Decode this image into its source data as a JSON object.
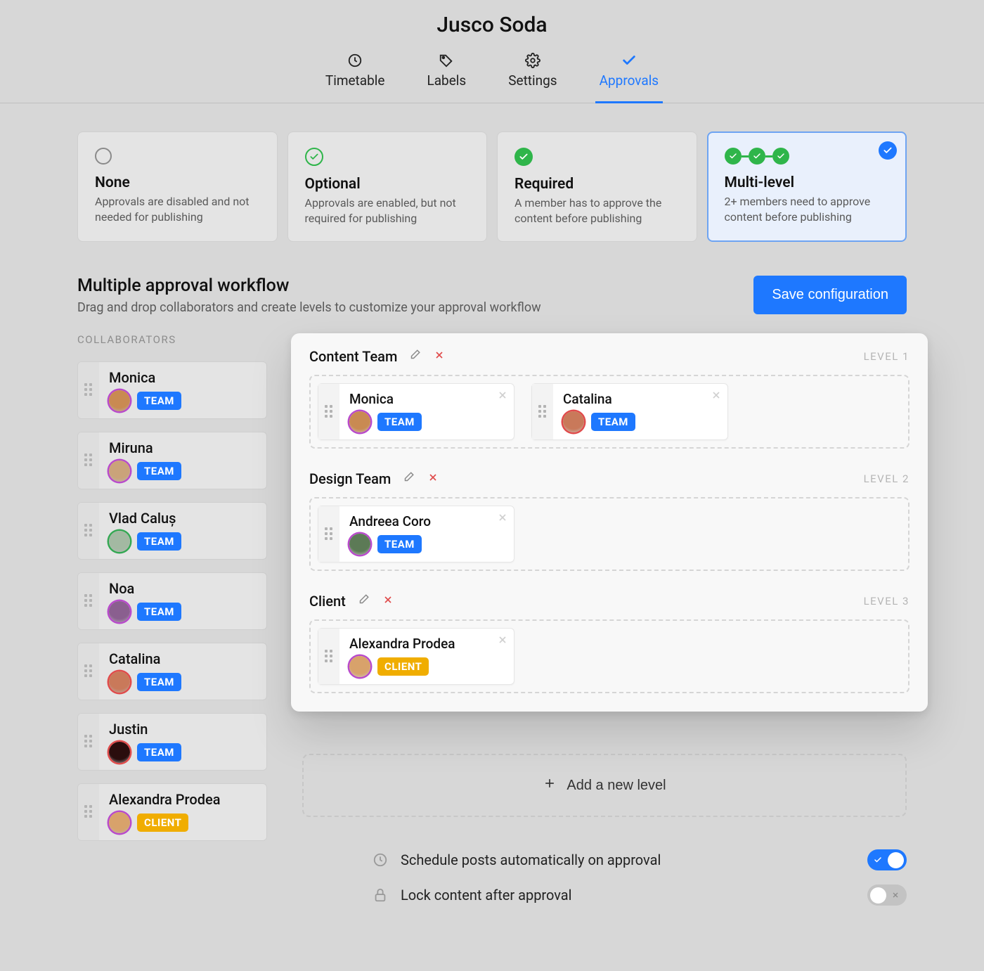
{
  "title": "Jusco Soda",
  "tabs": [
    {
      "label": "Timetable",
      "active": false
    },
    {
      "label": "Labels",
      "active": false
    },
    {
      "label": "Settings",
      "active": false
    },
    {
      "label": "Approvals",
      "active": true
    }
  ],
  "modes": [
    {
      "title": "None",
      "desc": "Approvals are disabled and not needed for publishing",
      "selected": false,
      "style": "none"
    },
    {
      "title": "Optional",
      "desc": "Approvals are enabled, but not required for publishing",
      "selected": false,
      "style": "optional"
    },
    {
      "title": "Required",
      "desc": "A member has to approve the content before publishing",
      "selected": false,
      "style": "required"
    },
    {
      "title": "Multi-level",
      "desc": "2+ members need to approve content before publishing",
      "selected": true,
      "style": "multi"
    }
  ],
  "section": {
    "title": "Multiple approval workflow",
    "subtitle": "Drag and drop collaborators and create levels to customize your approval workflow",
    "save_button": "Save configuration",
    "collaborators_heading": "COLLABORATORS"
  },
  "collaborators": [
    {
      "name": "Monica",
      "tag": "TEAM",
      "tag_type": "team",
      "avatar_color": "#c98a52",
      "avatar_ring": "#b84acb"
    },
    {
      "name": "Miruna",
      "tag": "TEAM",
      "tag_type": "team",
      "avatar_color": "#caa37a",
      "avatar_ring": "#b84acb"
    },
    {
      "name": "Vlad Caluș",
      "tag": "TEAM",
      "tag_type": "team",
      "avatar_color": "#a3b9a2",
      "avatar_ring": "#34a853"
    },
    {
      "name": "Noa",
      "tag": "TEAM",
      "tag_type": "team",
      "avatar_color": "#8a5f8f",
      "avatar_ring": "#b84acb"
    },
    {
      "name": "Catalina",
      "tag": "TEAM",
      "tag_type": "team",
      "avatar_color": "#c9795a",
      "avatar_ring": "#e04b4b"
    },
    {
      "name": "Justin",
      "tag": "TEAM",
      "tag_type": "team",
      "avatar_color": "#2a0d0d",
      "avatar_ring": "#e04b4b"
    },
    {
      "name": "Alexandra Prodea",
      "tag": "CLIENT",
      "tag_type": "client",
      "avatar_color": "#d8a26b",
      "avatar_ring": "#b84acb"
    }
  ],
  "levels": [
    {
      "name": "Content Team",
      "label": "LEVEL 1",
      "members": [
        {
          "name": "Monica",
          "tag": "TEAM",
          "tag_type": "team",
          "avatar_color": "#c98a52",
          "avatar_ring": "#b84acb"
        },
        {
          "name": "Catalina",
          "tag": "TEAM",
          "tag_type": "team",
          "avatar_color": "#c9795a",
          "avatar_ring": "#e04b4b"
        }
      ]
    },
    {
      "name": "Design Team",
      "label": "LEVEL 2",
      "members": [
        {
          "name": "Andreea Coro",
          "tag": "TEAM",
          "tag_type": "team",
          "avatar_color": "#5c7a56",
          "avatar_ring": "#b84acb"
        }
      ]
    },
    {
      "name": "Client",
      "label": "LEVEL 3",
      "members": [
        {
          "name": "Alexandra Prodea",
          "tag": "CLIENT",
          "tag_type": "client",
          "avatar_color": "#d8a26b",
          "avatar_ring": "#b84acb"
        }
      ]
    }
  ],
  "add_level_label": "Add a new level",
  "settings": [
    {
      "label": "Schedule posts automatically on approval",
      "on": true,
      "icon": "clock"
    },
    {
      "label": "Lock content after approval",
      "on": false,
      "icon": "lock"
    }
  ]
}
